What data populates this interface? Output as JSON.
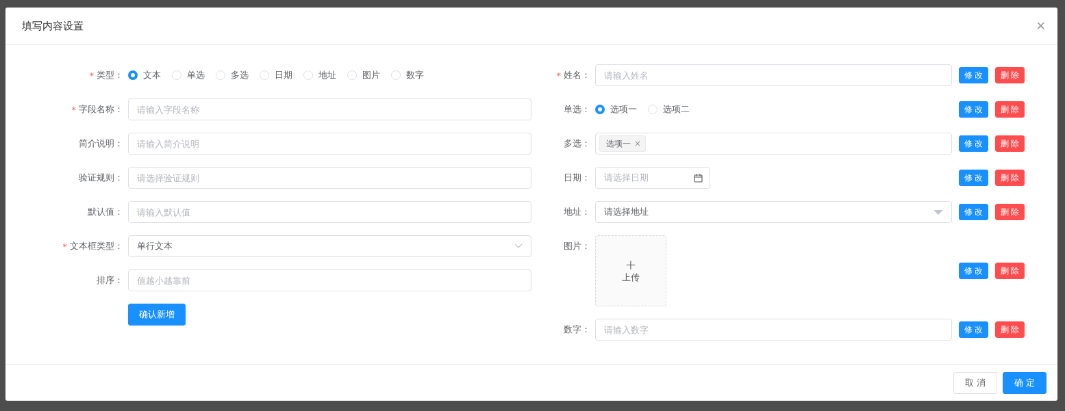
{
  "dialog": {
    "title": "填写内容设置",
    "close": "×"
  },
  "left_form": {
    "fields": [
      {
        "kind": "radio",
        "label": "类型：",
        "required_mark": "*",
        "options": [
          {
            "label": "文本",
            "selected": true
          },
          {
            "label": "单选",
            "selected": false
          },
          {
            "label": "多选",
            "selected": false
          },
          {
            "label": "日期",
            "selected": false
          },
          {
            "label": "地址",
            "selected": false
          },
          {
            "label": "图片",
            "selected": false
          },
          {
            "label": "数字",
            "selected": false
          }
        ]
      },
      {
        "kind": "input",
        "label": "字段名称：",
        "required_mark": "*",
        "placeholder": "请输入字段名称"
      },
      {
        "kind": "input",
        "label": "简介说明：",
        "placeholder": "请输入简介说明"
      },
      {
        "kind": "input",
        "label": "验证规则：",
        "placeholder": "请选择验证规则"
      },
      {
        "kind": "input",
        "label": "默认值：",
        "placeholder": "请输入默认值"
      },
      {
        "kind": "select",
        "label": "文本框类型：",
        "required_mark": "*",
        "value": "单行文本"
      },
      {
        "kind": "input",
        "label": "排序：",
        "placeholder": "值越小越靠前"
      }
    ],
    "submit": "确认新增"
  },
  "right_form": {
    "fields": [
      {
        "kind": "input",
        "label": "姓名：",
        "required_mark": "*",
        "placeholder": "请输入姓名",
        "edit": "修改",
        "delete": "删除"
      },
      {
        "kind": "radio",
        "label": "单选：",
        "options": [
          {
            "label": "选项一",
            "selected": true
          },
          {
            "label": "选项二",
            "selected": false
          }
        ],
        "edit": "修改",
        "delete": "删除"
      },
      {
        "kind": "multiselect",
        "label": "多选：",
        "tags": [
          {
            "label": "选项一",
            "remove": "×"
          }
        ],
        "edit": "修改",
        "delete": "删除"
      },
      {
        "kind": "date",
        "label": "日期：",
        "placeholder": "请选择日期",
        "edit": "修改",
        "delete": "删除"
      },
      {
        "kind": "cascader",
        "label": "地址：",
        "placeholder": "请选择地址",
        "edit": "修改",
        "delete": "删除"
      },
      {
        "kind": "upload",
        "label": "图片：",
        "plus": "+",
        "upload_text": "上传",
        "edit": "修改",
        "delete": "删除"
      },
      {
        "kind": "input",
        "label": "数字：",
        "placeholder": "请输入数字",
        "edit": "修改",
        "delete": "删除"
      }
    ]
  },
  "footer": {
    "cancel": "取消",
    "confirm": "确定"
  }
}
